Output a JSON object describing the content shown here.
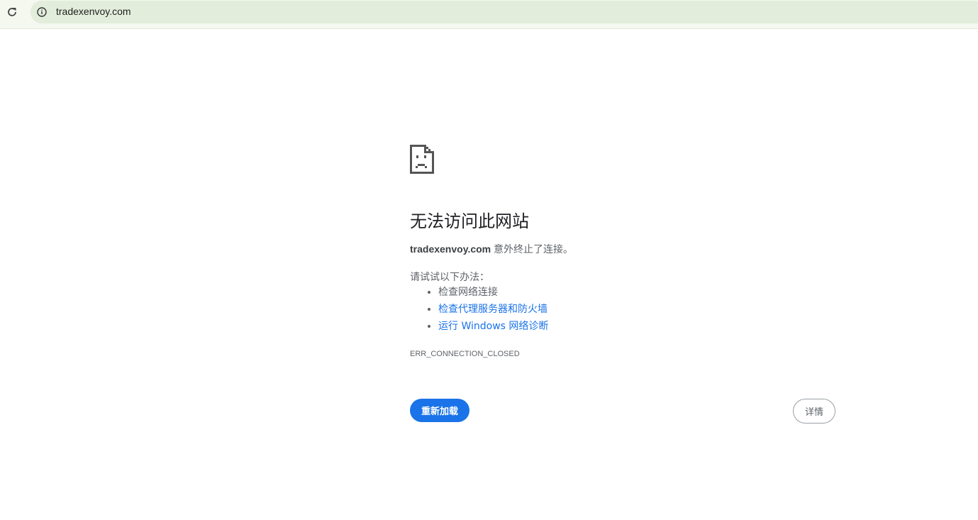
{
  "browser": {
    "url": "tradexenvoy.com"
  },
  "error": {
    "title": "无法访问此网站",
    "host": "tradexenvoy.com",
    "message": " 意外终止了连接。",
    "try_label": "请试试以下办法：",
    "suggestions": [
      "检查网络连接",
      "检查代理服务器和防火墙",
      "运行 Windows 网络诊断"
    ],
    "code": "ERR_CONNECTION_CLOSED"
  },
  "buttons": {
    "reload": "重新加载",
    "details": "详情"
  },
  "colors": {
    "accent": "#1a73e8",
    "toolbar": "#e3eddc"
  }
}
